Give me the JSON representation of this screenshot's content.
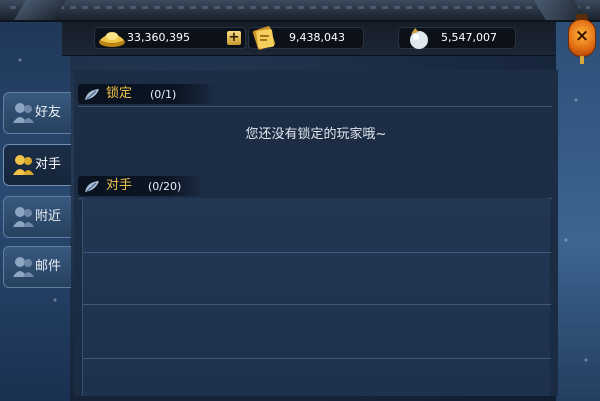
{
  "resources": {
    "gold": {
      "value": "33,360,395",
      "icon": "gold-ingot-icon",
      "add_label": "+"
    },
    "tickets": {
      "value": "9,438,043",
      "icon": "gold-ticket-icon"
    },
    "pearls": {
      "value": "5,547,007",
      "icon": "pearl-icon"
    }
  },
  "close": {
    "label": "×",
    "icon": "close-lantern-icon"
  },
  "tabs": [
    {
      "label": "好友",
      "icon": "friends-icon",
      "active": false
    },
    {
      "label": "对手",
      "icon": "opponents-icon",
      "active": true
    },
    {
      "label": "附近",
      "icon": "nearby-icon",
      "active": false
    },
    {
      "label": "邮件",
      "icon": "mail-icon",
      "active": false
    }
  ],
  "locked": {
    "title": "锁定",
    "count": "(0/1)",
    "empty_message": "您还没有锁定的玩家哦~"
  },
  "opponents": {
    "title": "对手",
    "count": "(0/20)"
  },
  "colors": {
    "section_title": "#f2c349",
    "panel_bg": "#1c2d45",
    "tab_bg": "#39597f",
    "lantern": "#e06a11"
  }
}
